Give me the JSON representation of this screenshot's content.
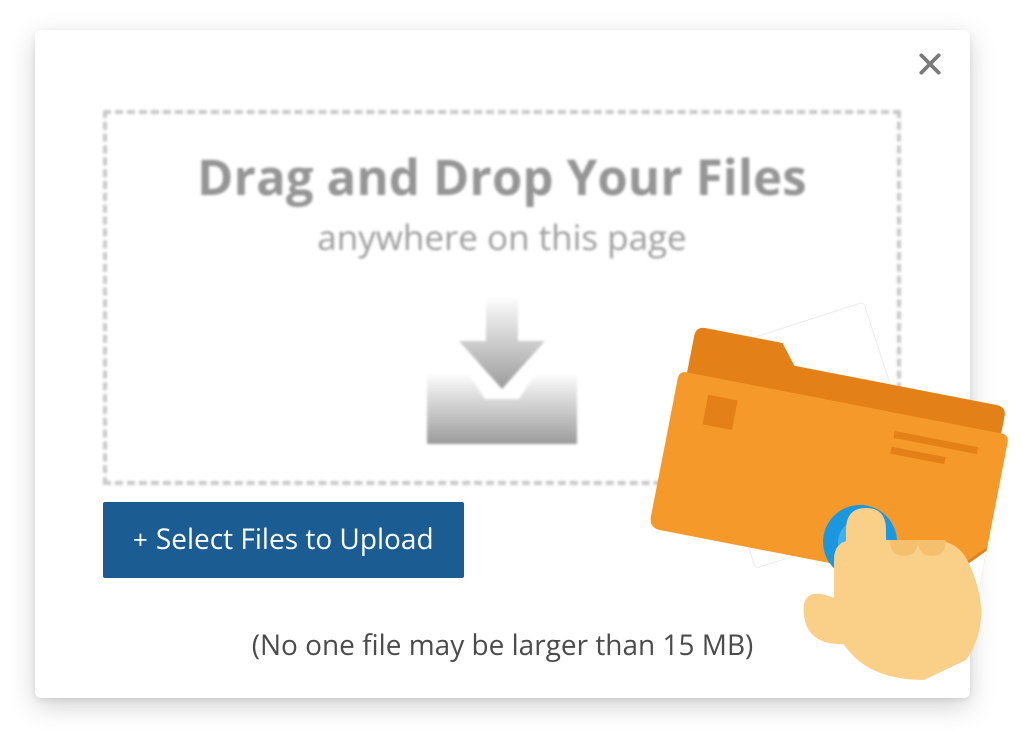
{
  "dropzone": {
    "title": "Drag and Drop Your Files",
    "subtitle": "anywhere on this page"
  },
  "actions": {
    "select_files_label": "Select Files to Upload",
    "plus": "+"
  },
  "note": "(No one file may be larger than 15 MB)",
  "colors": {
    "primary": "#1b5c93",
    "folder": "#f4992a",
    "folder_dark": "#e38017",
    "accent_blue": "#1a97df",
    "hand": "#fad089"
  }
}
